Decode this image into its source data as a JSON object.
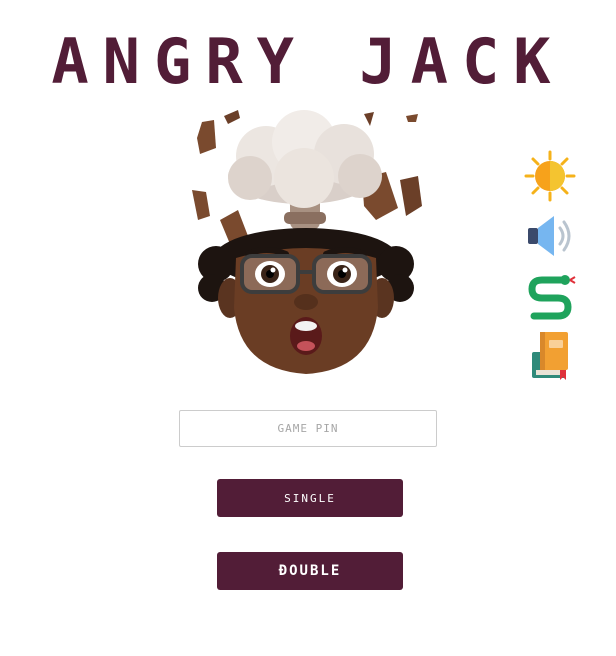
{
  "title": "ANGRY JACK",
  "pin_input": {
    "placeholder": "GAME PIN",
    "value": ""
  },
  "buttons": {
    "single": "SINGLE",
    "double": "ĐOUBLE"
  },
  "side_icons": [
    "sun-icon",
    "speaker-icon",
    "snake-icon",
    "books-icon"
  ],
  "colors": {
    "brand": "#521d37",
    "background": "#ffffff"
  }
}
